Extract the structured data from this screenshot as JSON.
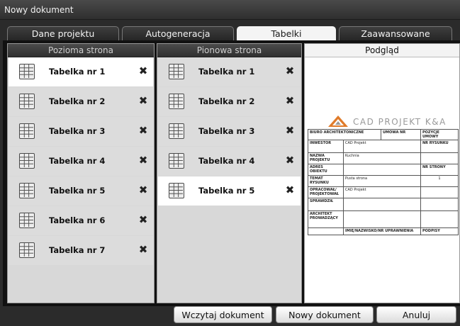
{
  "window": {
    "title": "Nowy dokument"
  },
  "tabs": [
    {
      "label": "Dane projektu",
      "active": false
    },
    {
      "label": "Autogeneracja",
      "active": false
    },
    {
      "label": "Tabelki",
      "active": true
    },
    {
      "label": "Zaawansowane",
      "active": false
    }
  ],
  "left_panel": {
    "header": "Pozioma strona",
    "items": [
      "Tabelka nr 1",
      "Tabelka nr 2",
      "Tabelka nr 3",
      "Tabelka nr 4",
      "Tabelka nr 5",
      "Tabelka nr 6",
      "Tabelka nr 7"
    ],
    "selected_index": 0
  },
  "middle_panel": {
    "header": "Pionowa strona",
    "items": [
      "Tabelka nr 1",
      "Tabelka nr 2",
      "Tabelka nr 3",
      "Tabelka nr 4",
      "Tabelka nr 5"
    ],
    "selected_index": 4
  },
  "preview": {
    "header": "Podgląd",
    "brand": "CAD PROJEKT K&A",
    "title_block": {
      "biuro": "BIURO ARCHITEKTONICZNE",
      "umowa_nr": "UMOWA NR",
      "pozycje_umowy": "POZYCJE UMOWY",
      "inwestor": "INWESTOR",
      "inwestor_val": "CAD Projekt",
      "nr_rysunku": "NR RYSUNKU",
      "nazwa_projektu": "NAZWA PROJEKTU",
      "nazwa_projektu_val": "Kuchnia",
      "adres_obiektu": "ADRES OBIEKTU",
      "nr_strony": "NR STRONY",
      "temat_rysunku": "TEMAT RYSUNKU",
      "temat_rysunku_val": "Pusta strona",
      "strona_val": "1",
      "opracowal": "OPRACOWAŁ/ PROJEKTOWAŁ",
      "opracowal_val": "CAD Projekt",
      "sprawdzil": "SPRAWDZIŁ",
      "architekt": "ARCHITEKT PROWADZĄCY",
      "imie": "IMIĘ/NAZWISKO/NR UPRAWNIENIA",
      "podpisy": "PODPISY"
    }
  },
  "buttons": {
    "load": "Wczytaj dokument",
    "new": "Nowy dokument",
    "cancel": "Anuluj"
  },
  "colors": {
    "logo_accent": "#e07b2a",
    "selected_row": "#ffffff",
    "row": "#dcdcdc"
  }
}
